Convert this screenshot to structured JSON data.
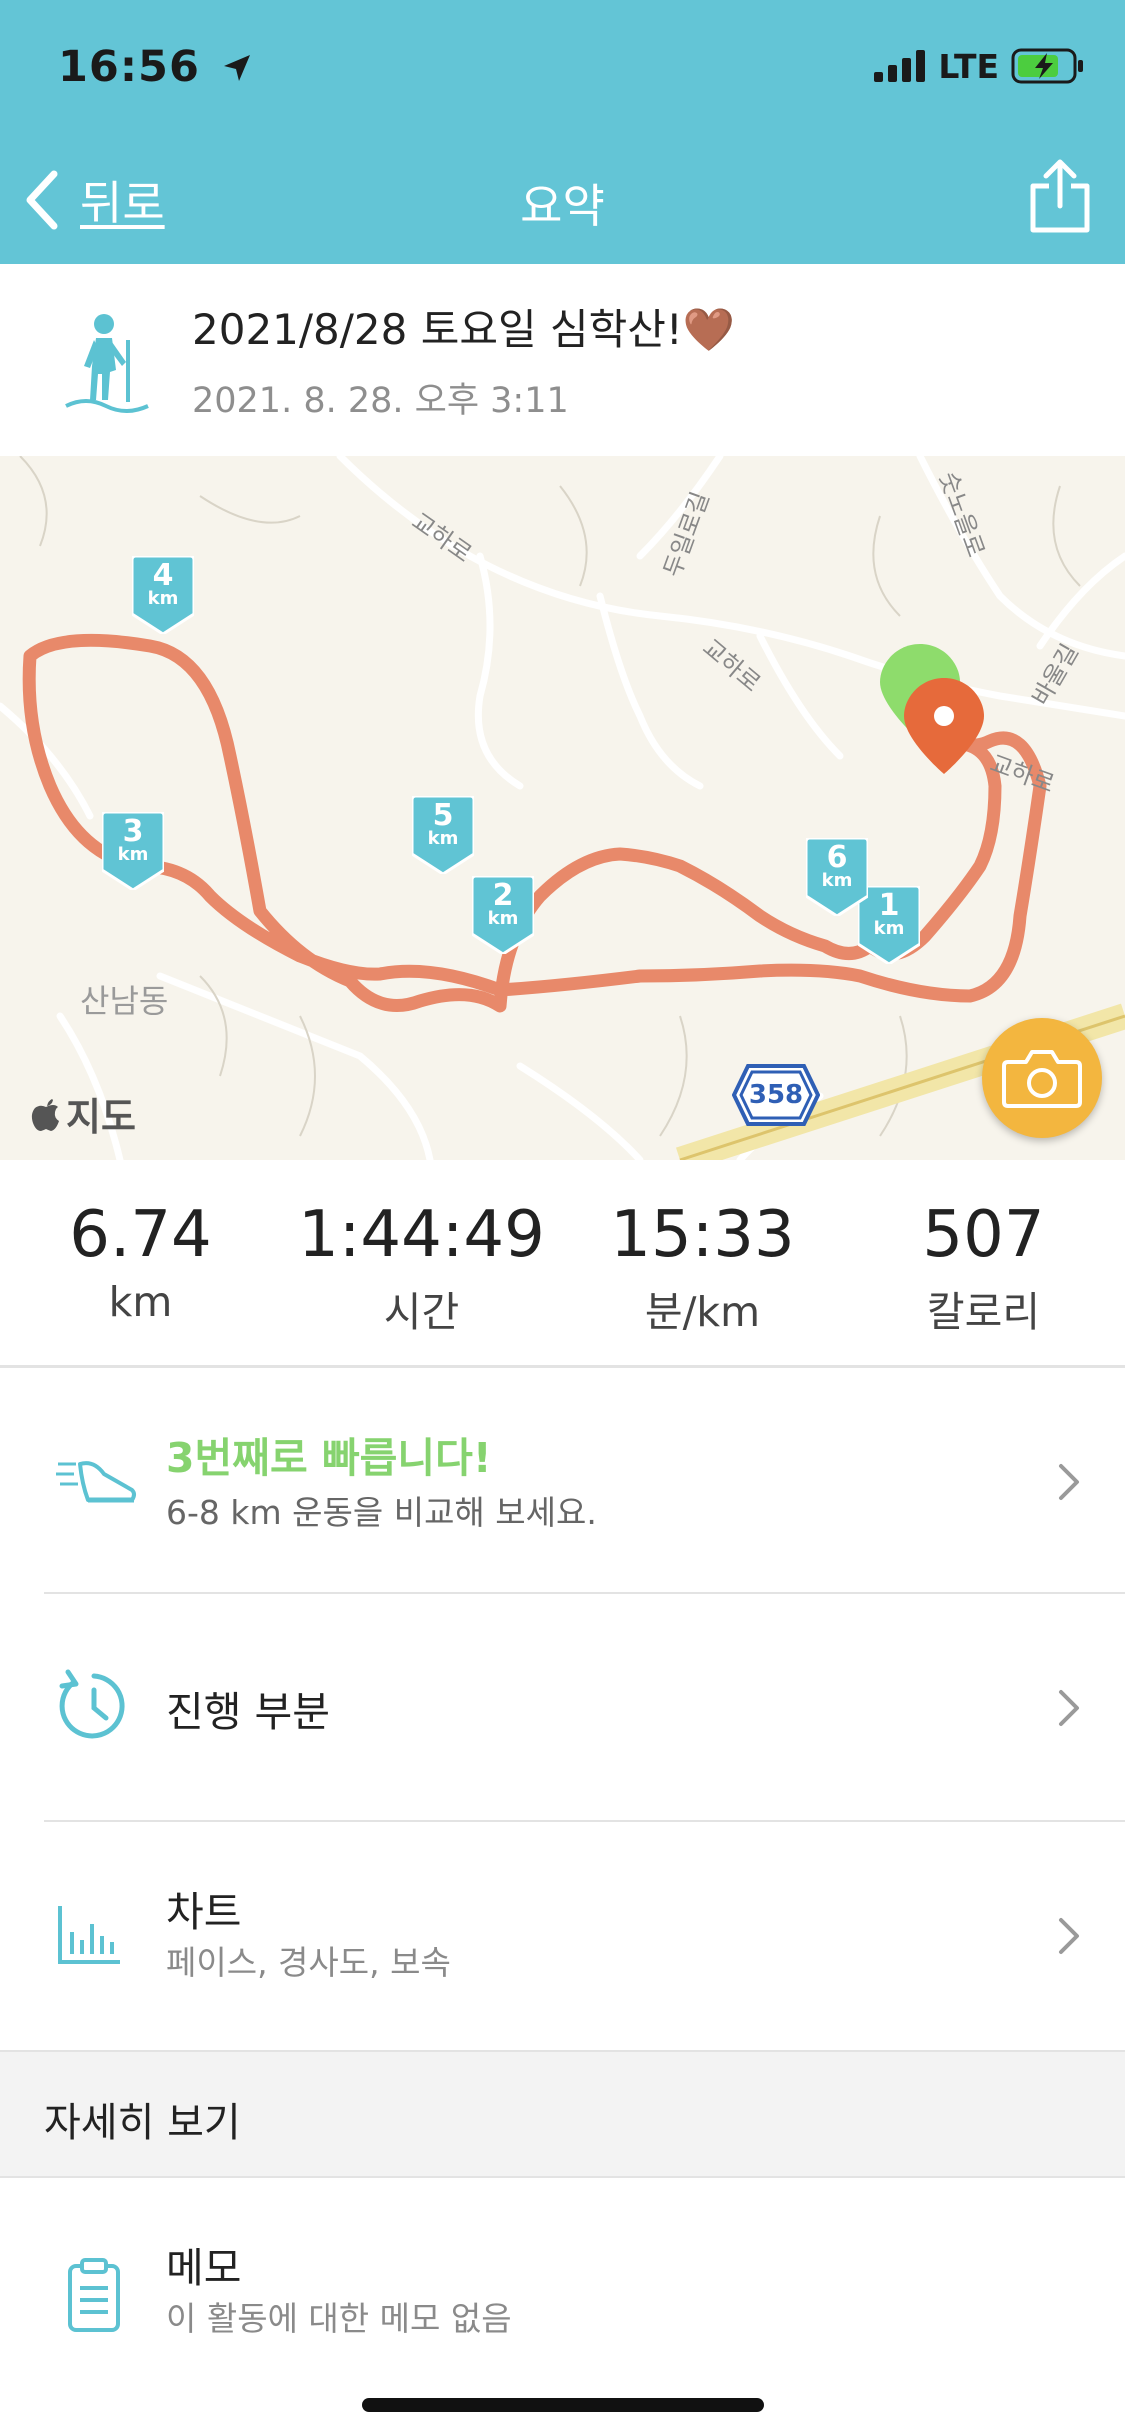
{
  "status_bar": {
    "time": "16:56",
    "network": "LTE"
  },
  "nav": {
    "back_label": "뒤로",
    "title": "요약"
  },
  "activity": {
    "title": "2021/8/28 토요일 심학산!🤎",
    "datetime": "2021. 8. 28. 오후 3:11",
    "type_icon": "hiking-icon"
  },
  "map": {
    "attribution": "지도",
    "road_labels": [
      "교하로",
      "교하로",
      "교하로",
      "두일로길",
      "숫노을로",
      "바울길"
    ],
    "place_label": "산남동",
    "route_badge": "358",
    "km_markers": [
      {
        "num": "1",
        "unit": "km"
      },
      {
        "num": "2",
        "unit": "km"
      },
      {
        "num": "3",
        "unit": "km"
      },
      {
        "num": "4",
        "unit": "km"
      },
      {
        "num": "5",
        "unit": "km"
      },
      {
        "num": "6",
        "unit": "km"
      }
    ],
    "route_color": "#e8896a",
    "marker_color": "#60c4d4"
  },
  "stats": [
    {
      "value": "6.74",
      "label": "km"
    },
    {
      "value": "1:44:49",
      "label": "시간"
    },
    {
      "value": "15:33",
      "label": "분/km"
    },
    {
      "value": "507",
      "label": "칼로리"
    }
  ],
  "rows": {
    "compare": {
      "title": "3번째로 빠릅니다!",
      "subtitle": "6-8 km 운동을 비교해 보세요.",
      "title_color": "#86d36f"
    },
    "splits": {
      "title": "진행 부분"
    },
    "charts": {
      "title": "차트",
      "subtitle": "페이스, 경사도, 보속"
    }
  },
  "details": {
    "header": "자세히 보기"
  },
  "memo": {
    "title": "메모",
    "subtitle": "이 활동에 대한 메모 없음"
  },
  "colors": {
    "accent": "#63c5d6",
    "camera": "#f3b63f"
  }
}
